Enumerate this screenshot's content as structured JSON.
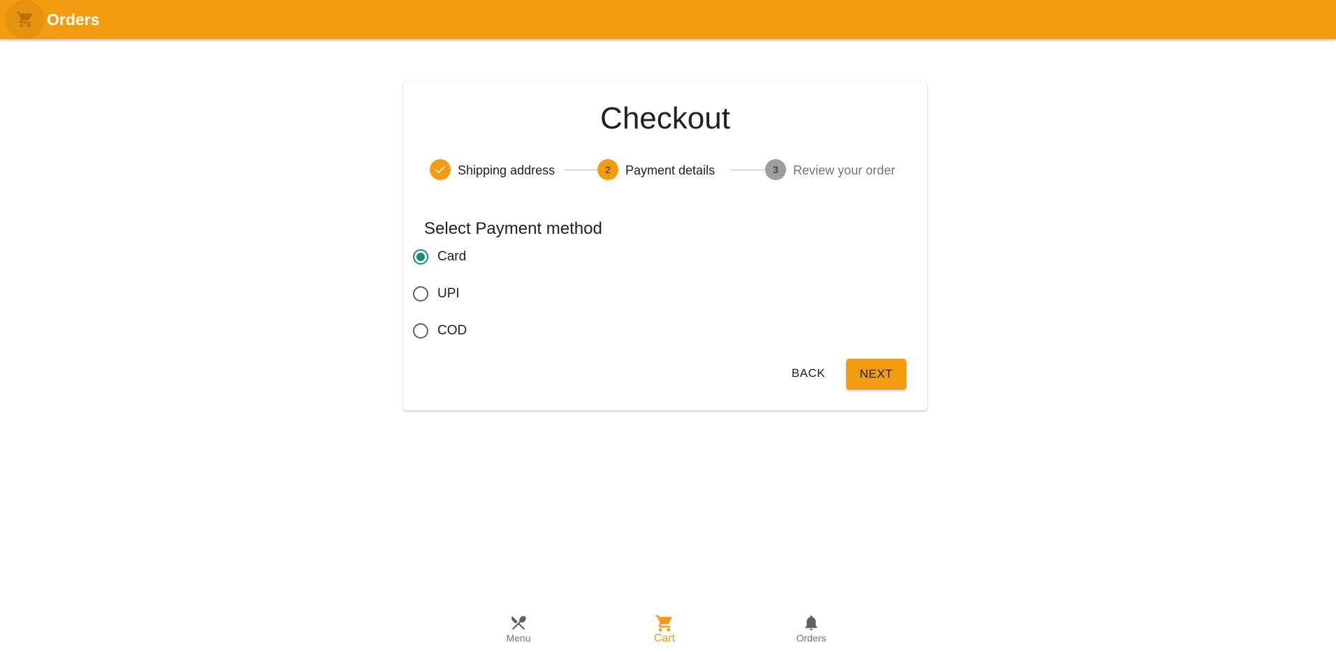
{
  "appbar": {
    "title": "Orders",
    "icon": "cart-icon"
  },
  "checkout": {
    "title": "Checkout",
    "steps": [
      {
        "label": "Shipping address",
        "state": "completed",
        "number": "1"
      },
      {
        "label": "Payment details",
        "state": "active",
        "number": "2"
      },
      {
        "label": "Review your order",
        "state": "pending",
        "number": "3"
      }
    ],
    "section_title": "Select Payment method",
    "payment_options": [
      {
        "label": "Card",
        "selected": true
      },
      {
        "label": "UPI",
        "selected": false
      },
      {
        "label": "COD",
        "selected": false
      }
    ],
    "back_label": "BACK",
    "next_label": "NEXT"
  },
  "bottom_nav": {
    "items": [
      {
        "label": "Menu",
        "icon": "utensils-icon",
        "active": false
      },
      {
        "label": "Cart",
        "icon": "cart-icon",
        "active": true
      },
      {
        "label": "Orders",
        "icon": "bell-icon",
        "active": false
      }
    ]
  },
  "colors": {
    "primary": "#f39c12",
    "radio_selected": "#1a8a7a",
    "step_pending": "#9e9e9e"
  }
}
